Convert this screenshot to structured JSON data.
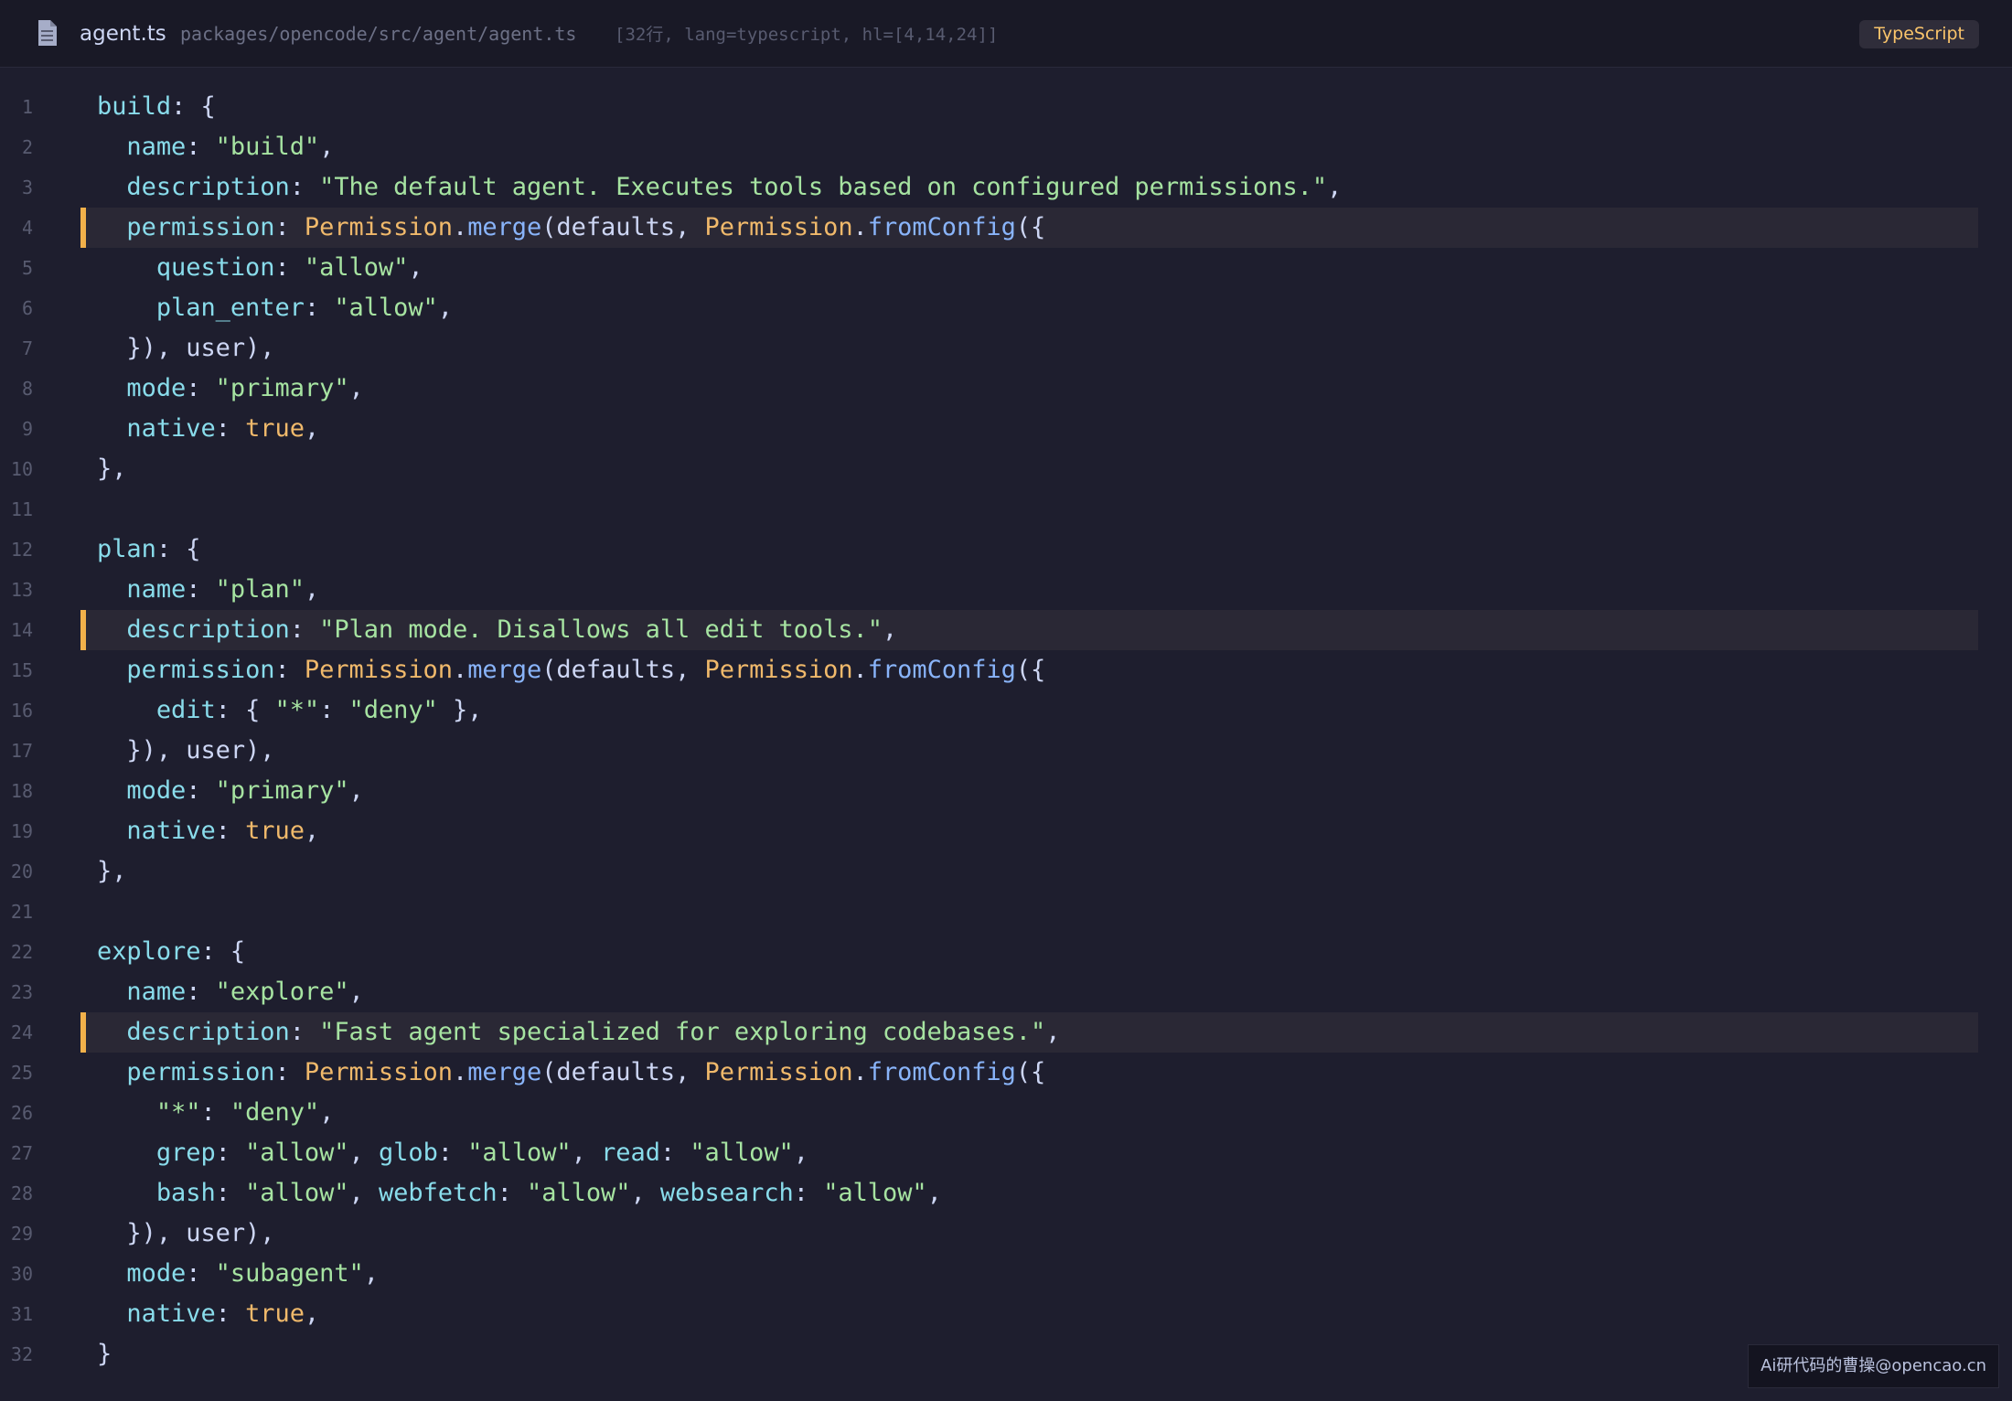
{
  "header": {
    "file_icon": "file-icon",
    "file_name": "agent.ts",
    "file_path": "packages/opencode/src/agent/agent.ts",
    "file_meta": "[32行, lang=typescript, hl=[4,14,24]]",
    "language": "TypeScript"
  },
  "colors": {
    "background": "#1e1e2e",
    "highlight_bar": "#f2b14a",
    "key": "#89dceb",
    "string": "#a6e3a1",
    "constant": "#f0b96b",
    "function": "#89b4fa",
    "punctuation": "#cdd6f4",
    "line_number": "#585b70"
  },
  "highlighted_lines": [
    4,
    14,
    24
  ],
  "code_lines": [
    [
      [
        "k",
        "build"
      ],
      [
        "p",
        ": {"
      ]
    ],
    [
      [
        "p",
        "  "
      ],
      [
        "k",
        "name"
      ],
      [
        "p",
        ": "
      ],
      [
        "s",
        "\"build\""
      ],
      [
        "p",
        ","
      ]
    ],
    [
      [
        "p",
        "  "
      ],
      [
        "k",
        "description"
      ],
      [
        "p",
        ": "
      ],
      [
        "s",
        "\"The default agent. Executes tools based on configured permissions.\""
      ],
      [
        "p",
        ","
      ]
    ],
    [
      [
        "p",
        "  "
      ],
      [
        "k",
        "permission"
      ],
      [
        "p",
        ": "
      ],
      [
        "c",
        "Permission"
      ],
      [
        "p",
        "."
      ],
      [
        "f",
        "merge"
      ],
      [
        "p",
        "(defaults, "
      ],
      [
        "c",
        "Permission"
      ],
      [
        "p",
        "."
      ],
      [
        "f",
        "fromConfig"
      ],
      [
        "p",
        "({"
      ]
    ],
    [
      [
        "p",
        "    "
      ],
      [
        "k",
        "question"
      ],
      [
        "p",
        ": "
      ],
      [
        "s",
        "\"allow\""
      ],
      [
        "p",
        ","
      ]
    ],
    [
      [
        "p",
        "    "
      ],
      [
        "k",
        "plan_enter"
      ],
      [
        "p",
        ": "
      ],
      [
        "s",
        "\"allow\""
      ],
      [
        "p",
        ","
      ]
    ],
    [
      [
        "p",
        "  }), user),"
      ]
    ],
    [
      [
        "p",
        "  "
      ],
      [
        "k",
        "mode"
      ],
      [
        "p",
        ": "
      ],
      [
        "s",
        "\"primary\""
      ],
      [
        "p",
        ","
      ]
    ],
    [
      [
        "p",
        "  "
      ],
      [
        "k",
        "native"
      ],
      [
        "p",
        ": "
      ],
      [
        "c",
        "true"
      ],
      [
        "p",
        ","
      ]
    ],
    [
      [
        "p",
        "},"
      ]
    ],
    [
      [
        "p",
        ""
      ]
    ],
    [
      [
        "k",
        "plan"
      ],
      [
        "p",
        ": {"
      ]
    ],
    [
      [
        "p",
        "  "
      ],
      [
        "k",
        "name"
      ],
      [
        "p",
        ": "
      ],
      [
        "s",
        "\"plan\""
      ],
      [
        "p",
        ","
      ]
    ],
    [
      [
        "p",
        "  "
      ],
      [
        "k",
        "description"
      ],
      [
        "p",
        ": "
      ],
      [
        "s",
        "\"Plan mode. Disallows all edit tools.\""
      ],
      [
        "p",
        ","
      ]
    ],
    [
      [
        "p",
        "  "
      ],
      [
        "k",
        "permission"
      ],
      [
        "p",
        ": "
      ],
      [
        "c",
        "Permission"
      ],
      [
        "p",
        "."
      ],
      [
        "f",
        "merge"
      ],
      [
        "p",
        "(defaults, "
      ],
      [
        "c",
        "Permission"
      ],
      [
        "p",
        "."
      ],
      [
        "f",
        "fromConfig"
      ],
      [
        "p",
        "({"
      ]
    ],
    [
      [
        "p",
        "    "
      ],
      [
        "k",
        "edit"
      ],
      [
        "p",
        ": { "
      ],
      [
        "s",
        "\"*\""
      ],
      [
        "p",
        ": "
      ],
      [
        "s",
        "\"deny\""
      ],
      [
        "p",
        " },"
      ]
    ],
    [
      [
        "p",
        "  }), user),"
      ]
    ],
    [
      [
        "p",
        "  "
      ],
      [
        "k",
        "mode"
      ],
      [
        "p",
        ": "
      ],
      [
        "s",
        "\"primary\""
      ],
      [
        "p",
        ","
      ]
    ],
    [
      [
        "p",
        "  "
      ],
      [
        "k",
        "native"
      ],
      [
        "p",
        ": "
      ],
      [
        "c",
        "true"
      ],
      [
        "p",
        ","
      ]
    ],
    [
      [
        "p",
        "},"
      ]
    ],
    [
      [
        "p",
        ""
      ]
    ],
    [
      [
        "k",
        "explore"
      ],
      [
        "p",
        ": {"
      ]
    ],
    [
      [
        "p",
        "  "
      ],
      [
        "k",
        "name"
      ],
      [
        "p",
        ": "
      ],
      [
        "s",
        "\"explore\""
      ],
      [
        "p",
        ","
      ]
    ],
    [
      [
        "p",
        "  "
      ],
      [
        "k",
        "description"
      ],
      [
        "p",
        ": "
      ],
      [
        "s",
        "\"Fast agent specialized for exploring codebases.\""
      ],
      [
        "p",
        ","
      ]
    ],
    [
      [
        "p",
        "  "
      ],
      [
        "k",
        "permission"
      ],
      [
        "p",
        ": "
      ],
      [
        "c",
        "Permission"
      ],
      [
        "p",
        "."
      ],
      [
        "f",
        "merge"
      ],
      [
        "p",
        "(defaults, "
      ],
      [
        "c",
        "Permission"
      ],
      [
        "p",
        "."
      ],
      [
        "f",
        "fromConfig"
      ],
      [
        "p",
        "({"
      ]
    ],
    [
      [
        "p",
        "    "
      ],
      [
        "s",
        "\"*\""
      ],
      [
        "p",
        ": "
      ],
      [
        "s",
        "\"deny\""
      ],
      [
        "p",
        ","
      ]
    ],
    [
      [
        "p",
        "    "
      ],
      [
        "k",
        "grep"
      ],
      [
        "p",
        ": "
      ],
      [
        "s",
        "\"allow\""
      ],
      [
        "p",
        ", "
      ],
      [
        "k",
        "glob"
      ],
      [
        "p",
        ": "
      ],
      [
        "s",
        "\"allow\""
      ],
      [
        "p",
        ", "
      ],
      [
        "k",
        "read"
      ],
      [
        "p",
        ": "
      ],
      [
        "s",
        "\"allow\""
      ],
      [
        "p",
        ","
      ]
    ],
    [
      [
        "p",
        "    "
      ],
      [
        "k",
        "bash"
      ],
      [
        "p",
        ": "
      ],
      [
        "s",
        "\"allow\""
      ],
      [
        "p",
        ", "
      ],
      [
        "k",
        "webfetch"
      ],
      [
        "p",
        ": "
      ],
      [
        "s",
        "\"allow\""
      ],
      [
        "p",
        ", "
      ],
      [
        "k",
        "websearch"
      ],
      [
        "p",
        ": "
      ],
      [
        "s",
        "\"allow\""
      ],
      [
        "p",
        ","
      ]
    ],
    [
      [
        "p",
        "  }), user),"
      ]
    ],
    [
      [
        "p",
        "  "
      ],
      [
        "k",
        "mode"
      ],
      [
        "p",
        ": "
      ],
      [
        "s",
        "\"subagent\""
      ],
      [
        "p",
        ","
      ]
    ],
    [
      [
        "p",
        "  "
      ],
      [
        "k",
        "native"
      ],
      [
        "p",
        ": "
      ],
      [
        "c",
        "true"
      ],
      [
        "p",
        ","
      ]
    ],
    [
      [
        "p",
        "}"
      ]
    ]
  ],
  "watermark": "Ai研代码的曹操@opencao.cn"
}
